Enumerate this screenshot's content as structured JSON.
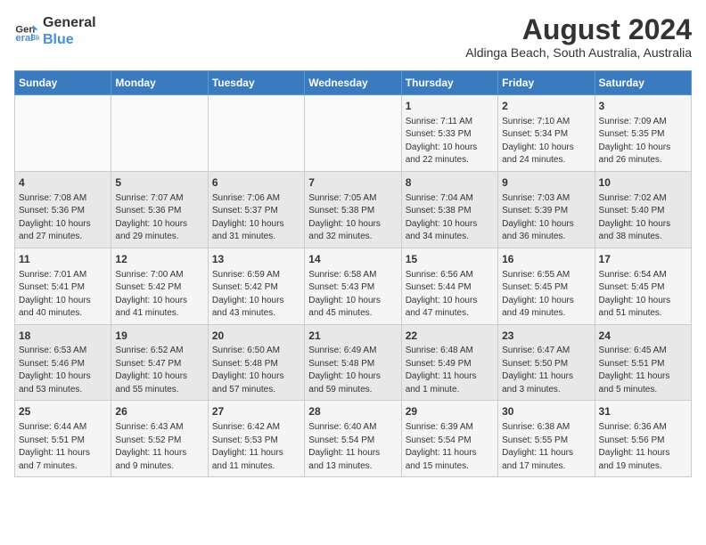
{
  "header": {
    "logo_line1": "General",
    "logo_line2": "Blue",
    "title": "August 2024",
    "subtitle": "Aldinga Beach, South Australia, Australia"
  },
  "days_of_week": [
    "Sunday",
    "Monday",
    "Tuesday",
    "Wednesday",
    "Thursday",
    "Friday",
    "Saturday"
  ],
  "weeks": [
    [
      {
        "day": "",
        "info": ""
      },
      {
        "day": "",
        "info": ""
      },
      {
        "day": "",
        "info": ""
      },
      {
        "day": "",
        "info": ""
      },
      {
        "day": "1",
        "info": "Sunrise: 7:11 AM\nSunset: 5:33 PM\nDaylight: 10 hours\nand 22 minutes."
      },
      {
        "day": "2",
        "info": "Sunrise: 7:10 AM\nSunset: 5:34 PM\nDaylight: 10 hours\nand 24 minutes."
      },
      {
        "day": "3",
        "info": "Sunrise: 7:09 AM\nSunset: 5:35 PM\nDaylight: 10 hours\nand 26 minutes."
      }
    ],
    [
      {
        "day": "4",
        "info": "Sunrise: 7:08 AM\nSunset: 5:36 PM\nDaylight: 10 hours\nand 27 minutes."
      },
      {
        "day": "5",
        "info": "Sunrise: 7:07 AM\nSunset: 5:36 PM\nDaylight: 10 hours\nand 29 minutes."
      },
      {
        "day": "6",
        "info": "Sunrise: 7:06 AM\nSunset: 5:37 PM\nDaylight: 10 hours\nand 31 minutes."
      },
      {
        "day": "7",
        "info": "Sunrise: 7:05 AM\nSunset: 5:38 PM\nDaylight: 10 hours\nand 32 minutes."
      },
      {
        "day": "8",
        "info": "Sunrise: 7:04 AM\nSunset: 5:38 PM\nDaylight: 10 hours\nand 34 minutes."
      },
      {
        "day": "9",
        "info": "Sunrise: 7:03 AM\nSunset: 5:39 PM\nDaylight: 10 hours\nand 36 minutes."
      },
      {
        "day": "10",
        "info": "Sunrise: 7:02 AM\nSunset: 5:40 PM\nDaylight: 10 hours\nand 38 minutes."
      }
    ],
    [
      {
        "day": "11",
        "info": "Sunrise: 7:01 AM\nSunset: 5:41 PM\nDaylight: 10 hours\nand 40 minutes."
      },
      {
        "day": "12",
        "info": "Sunrise: 7:00 AM\nSunset: 5:42 PM\nDaylight: 10 hours\nand 41 minutes."
      },
      {
        "day": "13",
        "info": "Sunrise: 6:59 AM\nSunset: 5:42 PM\nDaylight: 10 hours\nand 43 minutes."
      },
      {
        "day": "14",
        "info": "Sunrise: 6:58 AM\nSunset: 5:43 PM\nDaylight: 10 hours\nand 45 minutes."
      },
      {
        "day": "15",
        "info": "Sunrise: 6:56 AM\nSunset: 5:44 PM\nDaylight: 10 hours\nand 47 minutes."
      },
      {
        "day": "16",
        "info": "Sunrise: 6:55 AM\nSunset: 5:45 PM\nDaylight: 10 hours\nand 49 minutes."
      },
      {
        "day": "17",
        "info": "Sunrise: 6:54 AM\nSunset: 5:45 PM\nDaylight: 10 hours\nand 51 minutes."
      }
    ],
    [
      {
        "day": "18",
        "info": "Sunrise: 6:53 AM\nSunset: 5:46 PM\nDaylight: 10 hours\nand 53 minutes."
      },
      {
        "day": "19",
        "info": "Sunrise: 6:52 AM\nSunset: 5:47 PM\nDaylight: 10 hours\nand 55 minutes."
      },
      {
        "day": "20",
        "info": "Sunrise: 6:50 AM\nSunset: 5:48 PM\nDaylight: 10 hours\nand 57 minutes."
      },
      {
        "day": "21",
        "info": "Sunrise: 6:49 AM\nSunset: 5:48 PM\nDaylight: 10 hours\nand 59 minutes."
      },
      {
        "day": "22",
        "info": "Sunrise: 6:48 AM\nSunset: 5:49 PM\nDaylight: 11 hours\nand 1 minute."
      },
      {
        "day": "23",
        "info": "Sunrise: 6:47 AM\nSunset: 5:50 PM\nDaylight: 11 hours\nand 3 minutes."
      },
      {
        "day": "24",
        "info": "Sunrise: 6:45 AM\nSunset: 5:51 PM\nDaylight: 11 hours\nand 5 minutes."
      }
    ],
    [
      {
        "day": "25",
        "info": "Sunrise: 6:44 AM\nSunset: 5:51 PM\nDaylight: 11 hours\nand 7 minutes."
      },
      {
        "day": "26",
        "info": "Sunrise: 6:43 AM\nSunset: 5:52 PM\nDaylight: 11 hours\nand 9 minutes."
      },
      {
        "day": "27",
        "info": "Sunrise: 6:42 AM\nSunset: 5:53 PM\nDaylight: 11 hours\nand 11 minutes."
      },
      {
        "day": "28",
        "info": "Sunrise: 6:40 AM\nSunset: 5:54 PM\nDaylight: 11 hours\nand 13 minutes."
      },
      {
        "day": "29",
        "info": "Sunrise: 6:39 AM\nSunset: 5:54 PM\nDaylight: 11 hours\nand 15 minutes."
      },
      {
        "day": "30",
        "info": "Sunrise: 6:38 AM\nSunset: 5:55 PM\nDaylight: 11 hours\nand 17 minutes."
      },
      {
        "day": "31",
        "info": "Sunrise: 6:36 AM\nSunset: 5:56 PM\nDaylight: 11 hours\nand 19 minutes."
      }
    ]
  ]
}
